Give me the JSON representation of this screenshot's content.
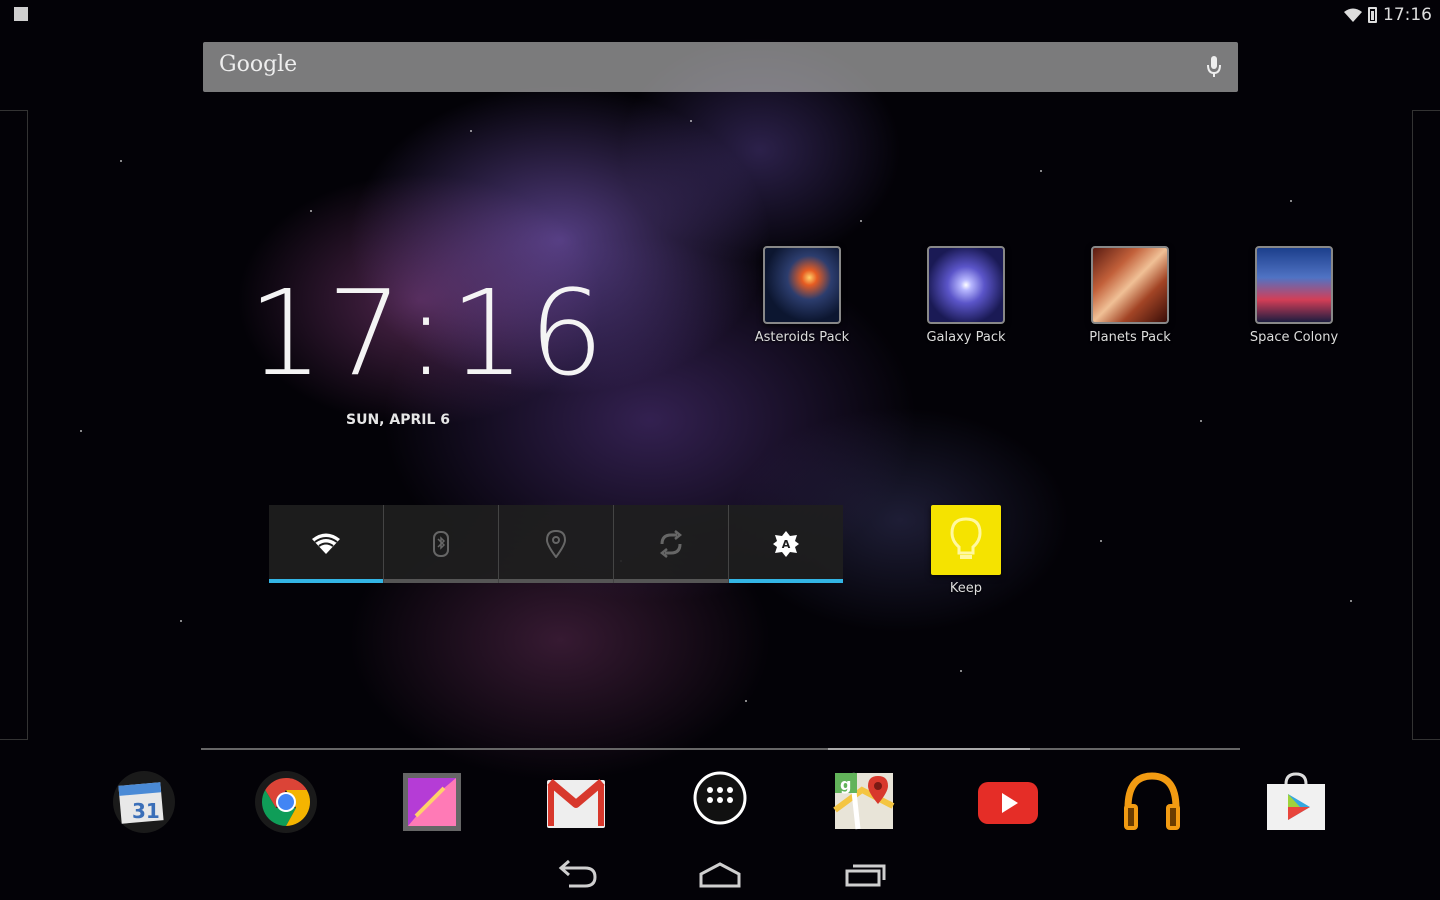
{
  "status_bar": {
    "time": "17:16",
    "icons": [
      "notification-icon",
      "wifi-icon",
      "battery-icon"
    ]
  },
  "search": {
    "logo_text": "Google",
    "icon": "mic-icon"
  },
  "clock_widget": {
    "time": "17:16",
    "date": "SUN, APRIL 6"
  },
  "apps": [
    {
      "label": "Asteroids Pack",
      "icon": "asteroids-pack-icon"
    },
    {
      "label": "Galaxy Pack",
      "icon": "galaxy-pack-icon"
    },
    {
      "label": "Planets Pack",
      "icon": "planets-pack-icon"
    },
    {
      "label": "Space Colony",
      "icon": "space-colony-icon"
    },
    {
      "label": "Keep",
      "icon": "keep-icon"
    }
  ],
  "power_control": {
    "toggles": [
      {
        "name": "wifi",
        "state": "on"
      },
      {
        "name": "bluetooth",
        "state": "off"
      },
      {
        "name": "location",
        "state": "off"
      },
      {
        "name": "sync",
        "state": "off"
      },
      {
        "name": "brightness",
        "state": "on"
      }
    ]
  },
  "dock": {
    "items": [
      "calendar-icon",
      "chrome-icon",
      "gallery-icon",
      "gmail-icon",
      "all-apps-icon",
      "maps-icon",
      "youtube-icon",
      "play-music-icon",
      "play-store-icon"
    ],
    "calendar_day": "31"
  },
  "navigation": [
    "back-button",
    "home-button",
    "recents-button"
  ],
  "colors": {
    "accent": "#33b5e5",
    "keep_yellow": "#f5e300",
    "youtube_red": "#e52d27"
  }
}
